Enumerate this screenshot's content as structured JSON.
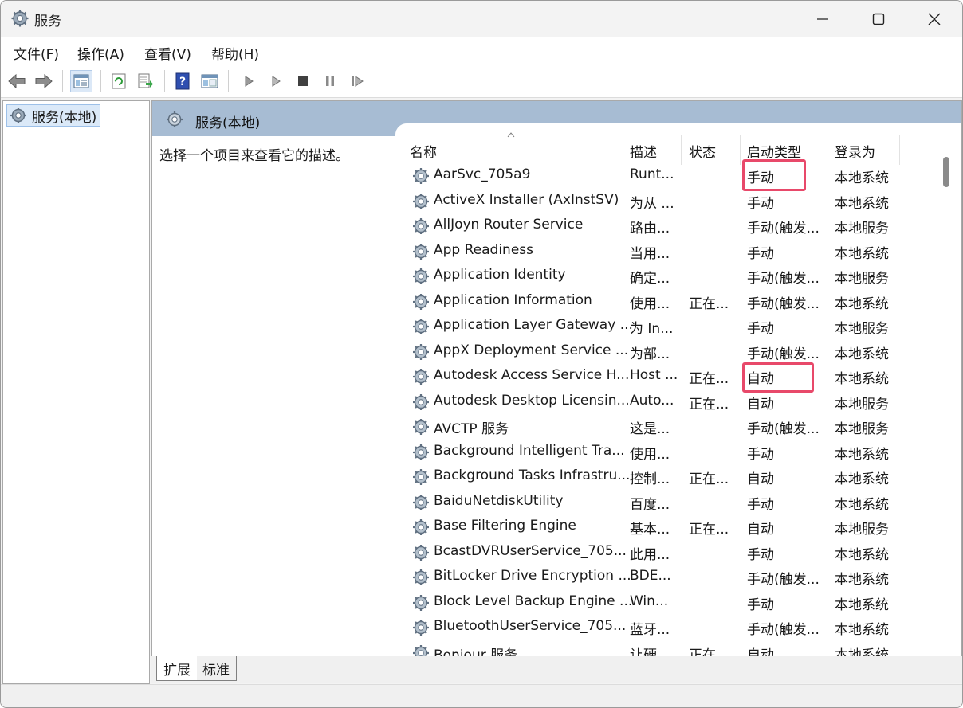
{
  "window": {
    "title": "服务"
  },
  "menu": [
    "文件(F)",
    "操作(A)",
    "查看(V)",
    "帮助(H)"
  ],
  "tree": {
    "root_label": "服务(本地)"
  },
  "pane": {
    "header_title": "服务(本地)",
    "description": "选择一个项目来查看它的描述。"
  },
  "columns": [
    "名称",
    "描述",
    "状态",
    "启动类型",
    "登录为"
  ],
  "services": [
    {
      "name": "AarSvc_705a9",
      "desc": "Runt...",
      "status": "",
      "startup": "手动",
      "logon": "本地系统"
    },
    {
      "name": "ActiveX Installer (AxInstSV)",
      "desc": "为从 ...",
      "status": "",
      "startup": "手动",
      "logon": "本地系统"
    },
    {
      "name": "AllJoyn Router Service",
      "desc": "路由...",
      "status": "",
      "startup": "手动(触发...",
      "logon": "本地服务"
    },
    {
      "name": "App Readiness",
      "desc": "当用...",
      "status": "",
      "startup": "手动",
      "logon": "本地系统"
    },
    {
      "name": "Application Identity",
      "desc": "确定...",
      "status": "",
      "startup": "手动(触发...",
      "logon": "本地服务"
    },
    {
      "name": "Application Information",
      "desc": "使用...",
      "status": "正在...",
      "startup": "手动(触发...",
      "logon": "本地系统"
    },
    {
      "name": "Application Layer Gateway ...",
      "desc": "为 In...",
      "status": "",
      "startup": "手动",
      "logon": "本地服务"
    },
    {
      "name": "AppX Deployment Service ...",
      "desc": "为部...",
      "status": "",
      "startup": "手动(触发...",
      "logon": "本地系统"
    },
    {
      "name": "Autodesk Access Service H...",
      "desc": "Host ...",
      "status": "正在...",
      "startup": "自动",
      "logon": "本地系统"
    },
    {
      "name": "Autodesk Desktop Licensin...",
      "desc": "Auto...",
      "status": "正在...",
      "startup": "自动",
      "logon": "本地服务"
    },
    {
      "name": "AVCTP 服务",
      "desc": "这是...",
      "status": "",
      "startup": "手动(触发...",
      "logon": "本地服务"
    },
    {
      "name": "Background Intelligent Tra...",
      "desc": "使用...",
      "status": "",
      "startup": "手动",
      "logon": "本地系统"
    },
    {
      "name": "Background Tasks Infrastru...",
      "desc": "控制...",
      "status": "正在...",
      "startup": "自动",
      "logon": "本地系统"
    },
    {
      "name": "BaiduNetdiskUtility",
      "desc": "百度...",
      "status": "",
      "startup": "手动",
      "logon": "本地系统"
    },
    {
      "name": "Base Filtering Engine",
      "desc": "基本...",
      "status": "正在...",
      "startup": "自动",
      "logon": "本地服务"
    },
    {
      "name": "BcastDVRUserService_705...",
      "desc": "此用...",
      "status": "",
      "startup": "手动",
      "logon": "本地系统"
    },
    {
      "name": "BitLocker Drive Encryption ...",
      "desc": "BDE...",
      "status": "",
      "startup": "手动(触发...",
      "logon": "本地系统"
    },
    {
      "name": "Block Level Backup Engine ...",
      "desc": "Win...",
      "status": "",
      "startup": "手动",
      "logon": "本地系统"
    },
    {
      "name": "BluetoothUserService_705...",
      "desc": "蓝牙...",
      "status": "",
      "startup": "手动(触发...",
      "logon": "本地系统"
    },
    {
      "name": "Bonjour 服务",
      "desc": "让硬...",
      "status": "正在...",
      "startup": "自动",
      "logon": "本地系统"
    }
  ],
  "tabs": [
    "扩展",
    "标准"
  ],
  "colors": {
    "header_bg": "#a7bcd3",
    "highlight": "#e8496a",
    "selection": "#dbe9f8"
  }
}
